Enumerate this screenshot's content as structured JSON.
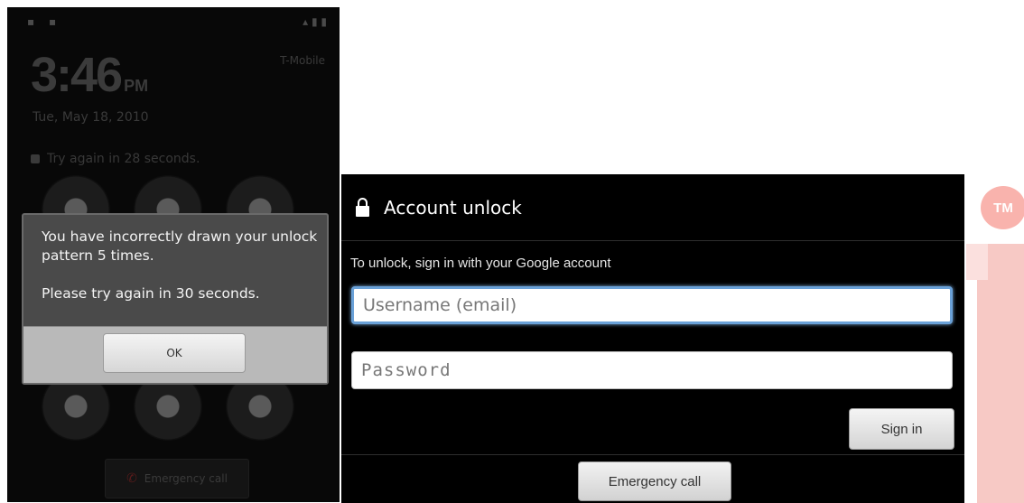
{
  "lock_screen": {
    "clock": "3:46",
    "ampm": "PM",
    "date": "Tue, May 18, 2010",
    "try_again_line": "Try again in 28 seconds.",
    "carrier": "T-Mobile",
    "emergency_label": "Emergency call",
    "dialog": {
      "message": "You have incorrectly drawn your unlock pattern 5 times.\n\nPlease try again in 30 seconds.",
      "ok_label": "OK"
    }
  },
  "account_unlock": {
    "title": "Account unlock",
    "subtitle": "To unlock, sign in with your Google account",
    "username_placeholder": "Username (email)",
    "password_placeholder": "Password",
    "sign_in_label": "Sign in",
    "emergency_label": "Emergency call"
  },
  "watermark": {
    "badge": "TM"
  },
  "colors": {
    "focus_border": "#6aa1d8",
    "watermark": "#f9b3ad",
    "dialog_body": "#4a4a4a",
    "dialog_footer": "#b9b9b9"
  }
}
